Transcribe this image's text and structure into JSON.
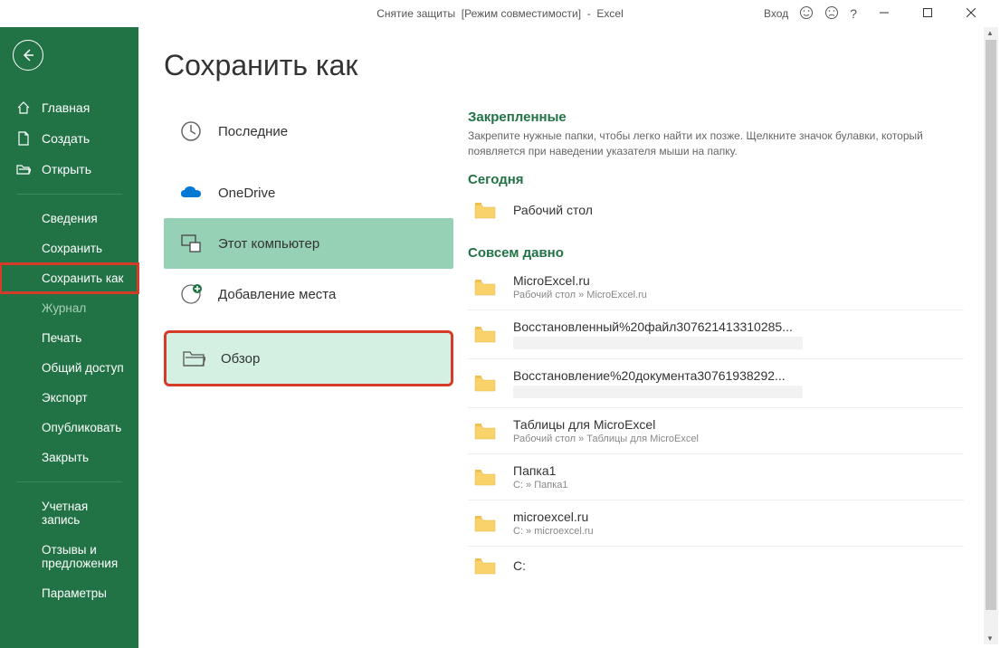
{
  "titlebar": {
    "title": "Снятие защиты  [Режим совместимости]  -  Excel",
    "signin": "Вход"
  },
  "sidebar": {
    "home": "Главная",
    "new": "Создать",
    "open": "Открыть",
    "info": "Сведения",
    "save": "Сохранить",
    "save_as": "Сохранить как",
    "history": "Журнал",
    "print": "Печать",
    "share": "Общий доступ",
    "export": "Экспорт",
    "publish": "Опубликовать",
    "close": "Закрыть",
    "account": "Учетная запись",
    "feedback": "Отзывы и предложения",
    "options": "Параметры"
  },
  "page": {
    "title": "Сохранить как"
  },
  "locations": {
    "recent": "Последние",
    "onedrive": "OneDrive",
    "this_pc": "Этот компьютер",
    "add_place": "Добавление места",
    "browse": "Обзор"
  },
  "pinned": {
    "header": "Закрепленные",
    "desc": "Закрепите нужные папки, чтобы легко найти их позже. Щелкните значок булавки, который появляется при наведении указателя мыши на папку."
  },
  "sections": {
    "today": "Сегодня",
    "older": "Совсем давно"
  },
  "folders": {
    "today": [
      {
        "name": "Рабочий стол",
        "path": ""
      }
    ],
    "older": [
      {
        "name": "MicroExcel.ru",
        "path": "Рабочий стол » MicroExcel.ru"
      },
      {
        "name": "Восстановленный%20файл307621413310285...",
        "path": "",
        "blurred": true
      },
      {
        "name": "Восстановление%20документа30761938292...",
        "path": "",
        "blurred": true
      },
      {
        "name": "Таблицы для MicroExcel",
        "path": "Рабочий стол » Таблицы для MicroExcel"
      },
      {
        "name": "Папка1",
        "path": "C: » Папка1"
      },
      {
        "name": "microexcel.ru",
        "path": "C: » microexcel.ru"
      },
      {
        "name": "C:",
        "path": ""
      }
    ]
  }
}
